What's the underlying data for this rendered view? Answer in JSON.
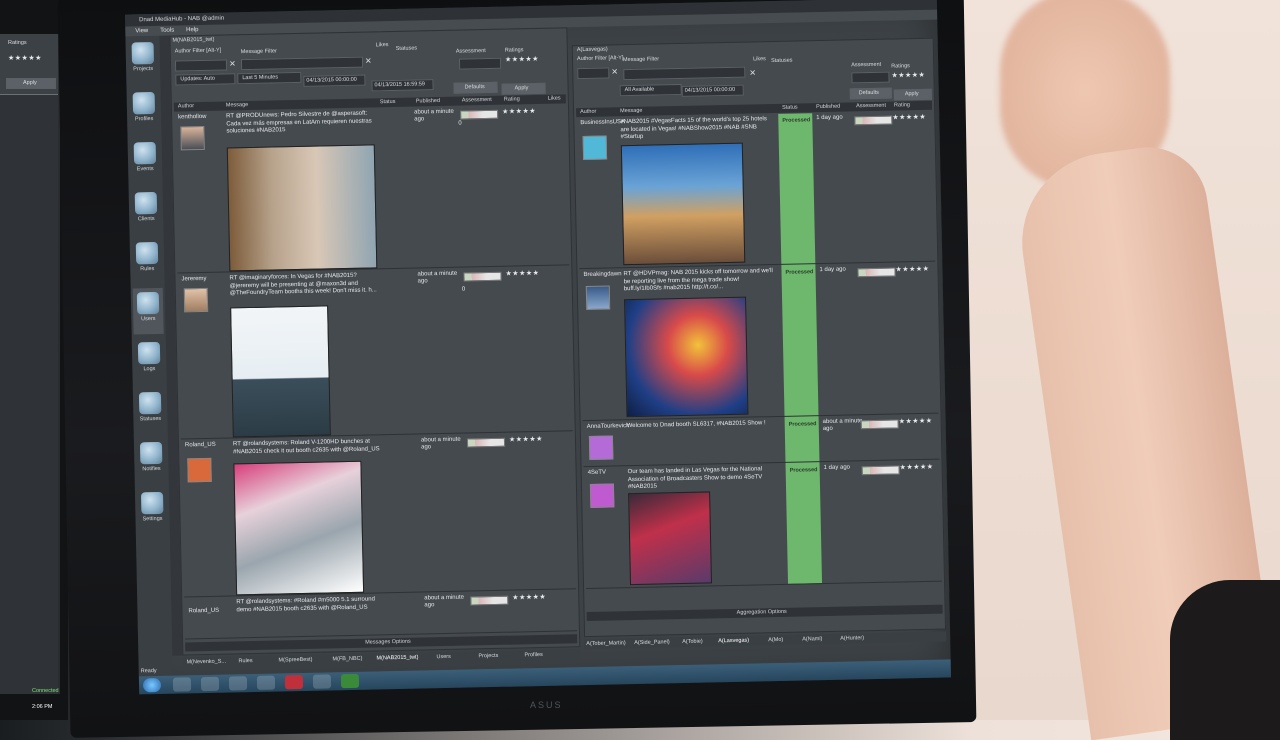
{
  "app": {
    "title": "Dnad MediaHub - NAB @admin"
  },
  "menu": [
    "View",
    "Tools",
    "Help"
  ],
  "sidebar": [
    {
      "label": "Projects",
      "icon": "projects-icon"
    },
    {
      "label": "Profiles",
      "icon": "profiles-icon"
    },
    {
      "label": "Events",
      "icon": "events-icon"
    },
    {
      "label": "Clients",
      "icon": "clients-icon"
    },
    {
      "label": "Rules",
      "icon": "rules-icon"
    },
    {
      "label": "Users",
      "icon": "users-icon"
    },
    {
      "label": "Logs",
      "icon": "logs-icon"
    },
    {
      "label": "Statuses",
      "icon": "statuses-icon"
    },
    {
      "label": "Notifies",
      "icon": "notifies-icon"
    },
    {
      "label": "Settings",
      "icon": "settings-icon"
    }
  ],
  "left_pane": {
    "tab": "M(NAB2015_twt)",
    "filters": {
      "author_filter": "Author Filter [Alt-Y]",
      "message_filter": "Message Filter",
      "likes": "Likes",
      "statuses": "Statuses",
      "assessment": "Assessment",
      "ratings": "Ratings",
      "updates": "Updates: Auto",
      "last_minutes": "Last 5 Minutes",
      "date_from": "04/13/2015 00:00:00",
      "date_to": "04/13/2015 16:59:59",
      "defaults": "Defaults",
      "apply": "Apply"
    },
    "columns": [
      "Author",
      "Message",
      "Status",
      "Published",
      "Assessment",
      "Rating",
      "Likes"
    ],
    "rows": [
      {
        "author": "kenthollow",
        "message": "RT @PRODUnews: Pedro Silvestre de @asperasoft: Cada vez más empresas en LatAm requieren nuestras soluciones #NAB2015",
        "published": "about a minute ago",
        "likes": "0"
      },
      {
        "author": "Jereremy",
        "message": "RT @imaginaryforces: In Vegas for #NAB2015? @jereremy will be presenting at @maxon3d and @TheFoundryTeam booths this week! Don't miss it. h...",
        "published": "about a minute ago",
        "likes": "0"
      },
      {
        "author": "Roland_US",
        "message": "RT @rolandsystems: Roland V-1200HD bunches at #NAB2015 check it out booth c2635 with @Roland_US",
        "published": "about a minute ago",
        "likes": "0"
      },
      {
        "author": "Roland_US",
        "message": "RT @rolandsystems: #Roland #m5000 5.1 surround demo #NAB2015 booth c2635 with @Roland_US",
        "published": "about a minute ago",
        "likes": ""
      }
    ],
    "footer": "Messages Options",
    "stars": "★★★★★"
  },
  "right_pane": {
    "tab": "A(Lasvegas)",
    "filters": {
      "author_filter": "Author Filter [Alt-Y]",
      "message_filter": "Message Filter",
      "likes": "Likes",
      "statuses": "Statuses",
      "assessment": "Assessment",
      "ratings": "Ratings",
      "all_available": "All Available",
      "date_to": "04/13/2015 00:00:00",
      "defaults": "Defaults",
      "apply": "Apply"
    },
    "columns": [
      "Author",
      "Message",
      "Status",
      "Published",
      "Assessment",
      "Rating"
    ],
    "rows": [
      {
        "author": "BusinessInsUSA",
        "message": "#NAB2015 #VegasFacts 15 of the world's top 25 hotels are located in Vegas! #NABShow2015 #NAB #SNB #Startup",
        "status": "Processed",
        "published": "1 day ago"
      },
      {
        "author": "Breakingdawn",
        "message": "RT @HDVPmag: NAB 2015 kicks off tomorrow and we'll be reporting live from the mega trade show! buff.ly/1Ib0Sfs #nab2015 http://t.co/...",
        "status": "Processed",
        "published": "1 day ago"
      },
      {
        "author": "AnnaTourkevich",
        "message": "Welcome to Dnad booth SL6317, #NAB2015 Show !",
        "status": "Processed",
        "published": "about a minute ago"
      },
      {
        "author": "4SeTV",
        "message": "Our team has landed in Las Vegas for the National Association of Broadcasters Show to demo 4SeTV #NAB2015",
        "status": "Processed",
        "published": "1 day ago"
      }
    ],
    "footer": "Aggregation Options",
    "stars": "★★★★★"
  },
  "bottom_tabs_left": [
    "M(Nevenko_S...",
    "Rules",
    "M(SpreeBest)",
    "M(FB_NBC)",
    "M(NAB2015_twt)",
    "Users",
    "Projects",
    "Profiles"
  ],
  "bottom_tabs_right": [
    "A(Tober_Martin)",
    "A(Side_Panel)",
    "A(Tobie)",
    "A(Lasvegas)",
    "A(Mo)",
    "A(Nami)",
    "A(Hunter)"
  ],
  "status_bar": "Ready",
  "left_monitor": {
    "ratings": "Ratings",
    "apply": "Apply",
    "connected": "Connected",
    "time": "2:06 PM"
  },
  "monitor_brand": "ASUS",
  "colors": {
    "processed": "#6db86d",
    "panel": "#454a4f",
    "header": "#2f3337"
  }
}
